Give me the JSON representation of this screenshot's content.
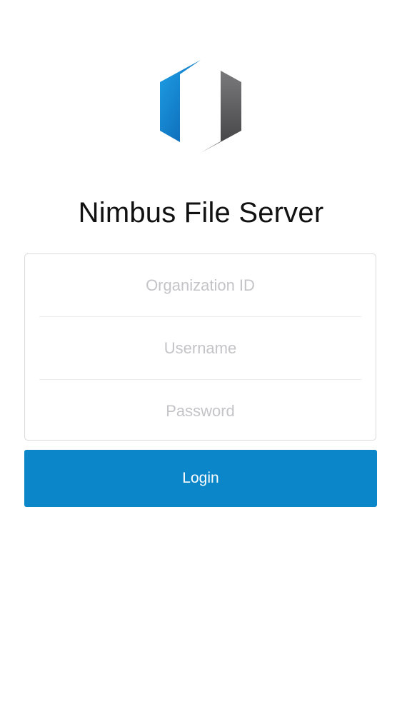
{
  "app": {
    "title": "Nimbus File Server",
    "logo_icon": "nimbus-hexagon-logo",
    "accent_color": "#0b86c9"
  },
  "login_form": {
    "organization_id": {
      "placeholder": "Organization ID",
      "value": ""
    },
    "username": {
      "placeholder": "Username",
      "value": ""
    },
    "password": {
      "placeholder": "Password",
      "value": ""
    },
    "submit_label": "Login"
  }
}
